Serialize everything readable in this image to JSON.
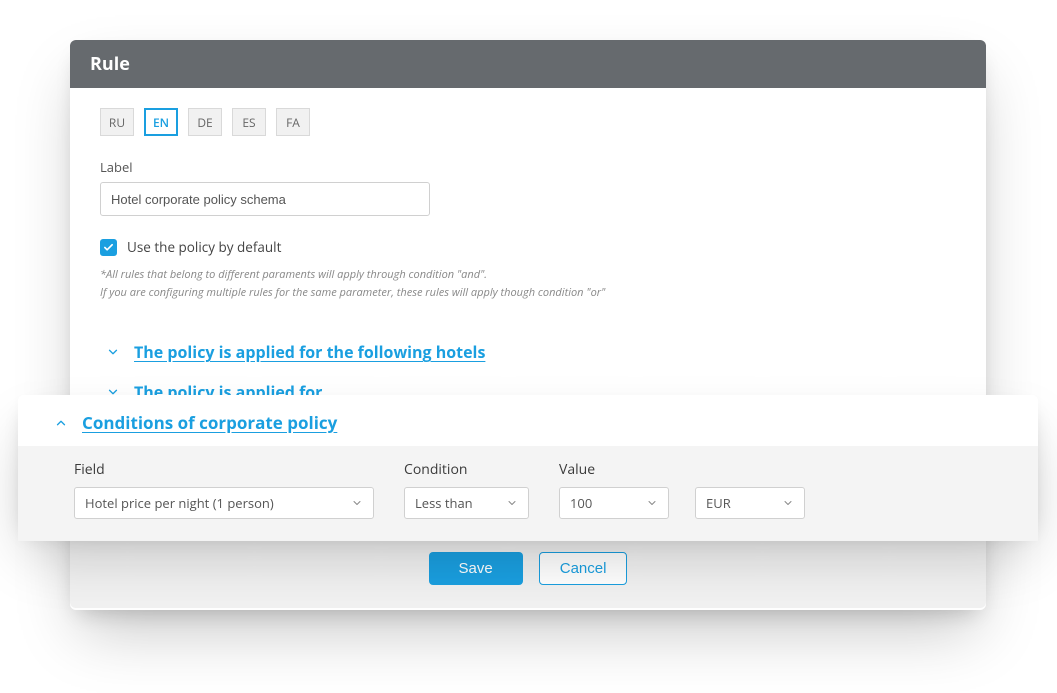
{
  "header": {
    "title": "Rule"
  },
  "languages": [
    "RU",
    "EN",
    "DE",
    "ES",
    "FA"
  ],
  "active_language": "EN",
  "label_field": {
    "label": "Label",
    "value": "Hotel corporate policy schema"
  },
  "default_checkbox": {
    "checked": true,
    "label": "Use the policy by default"
  },
  "fineprint": {
    "line1": "*All rules that belong to different paraments will apply through condition \"and\".",
    "line2": "If you are configuring multiple rules for the same parameter, these rules will apply though condition \"or\""
  },
  "sections": {
    "hotels": {
      "title": "The policy is applied for the following hotels",
      "expanded": false
    },
    "applied_for": {
      "title": "The policy is applied for",
      "expanded": false
    },
    "conditions": {
      "title": "Conditions of corporate policy",
      "expanded": true
    }
  },
  "conditions_form": {
    "field_label": "Field",
    "condition_label": "Condition",
    "value_label": "Value",
    "field_value": "Hotel price per night (1 person)",
    "condition_value": "Less than",
    "value_value": "100",
    "currency_value": "EUR"
  },
  "footer": {
    "save": "Save",
    "cancel": "Cancel"
  }
}
